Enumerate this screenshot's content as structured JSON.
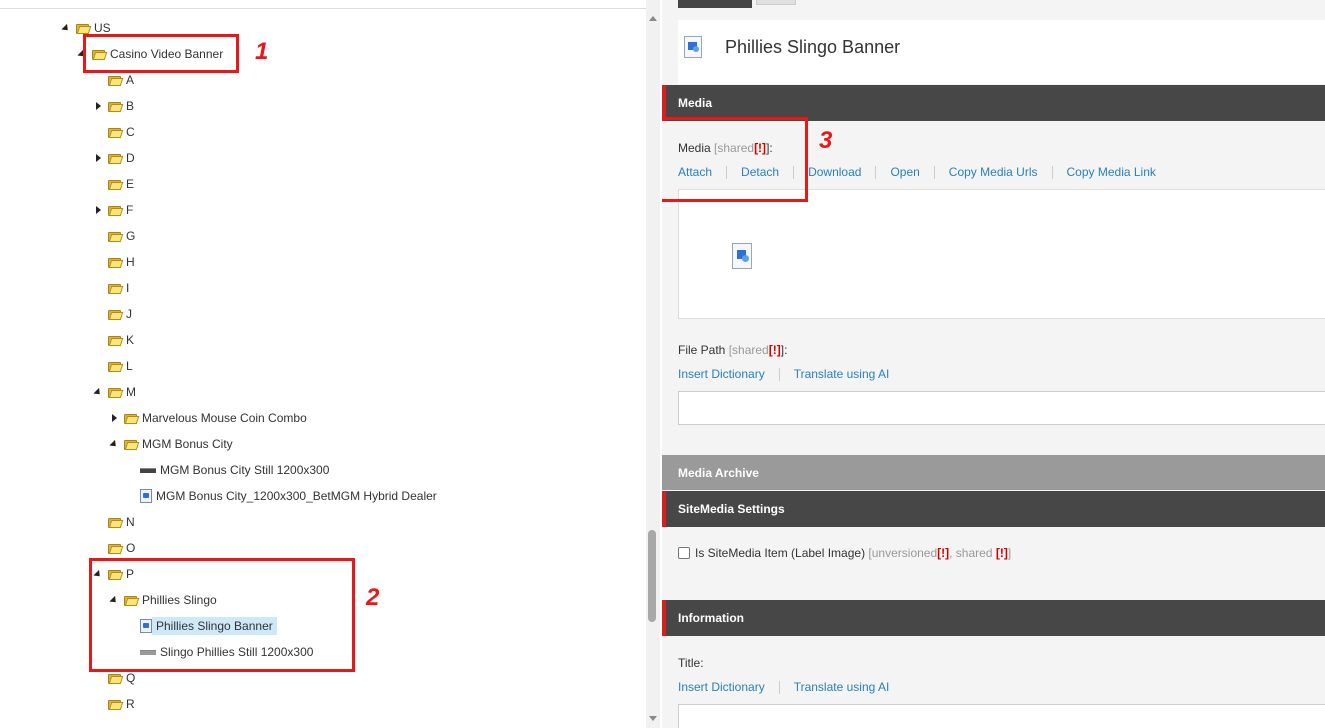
{
  "tree": {
    "nodes": [
      {
        "label": "US",
        "type": "folder",
        "expander": "down"
      },
      {
        "label": "Casino Video Banner",
        "type": "folder",
        "expander": "down"
      },
      {
        "label": "A",
        "type": "folder",
        "expander": "none"
      },
      {
        "label": "B",
        "type": "folder",
        "expander": "right"
      },
      {
        "label": "C",
        "type": "folder",
        "expander": "none"
      },
      {
        "label": "D",
        "type": "folder",
        "expander": "right"
      },
      {
        "label": "E",
        "type": "folder",
        "expander": "none"
      },
      {
        "label": "F",
        "type": "folder",
        "expander": "right"
      },
      {
        "label": "G",
        "type": "folder",
        "expander": "none"
      },
      {
        "label": "H",
        "type": "folder",
        "expander": "none"
      },
      {
        "label": "I",
        "type": "folder",
        "expander": "none"
      },
      {
        "label": "J",
        "type": "folder",
        "expander": "none"
      },
      {
        "label": "K",
        "type": "folder",
        "expander": "none"
      },
      {
        "label": "L",
        "type": "folder",
        "expander": "none"
      },
      {
        "label": "M",
        "type": "folder",
        "expander": "down"
      },
      {
        "label": "Marvelous Mouse Coin Combo",
        "type": "folder",
        "expander": "right"
      },
      {
        "label": "MGM Bonus City",
        "type": "folder",
        "expander": "down"
      },
      {
        "label": "MGM Bonus City Still 1200x300",
        "type": "image",
        "expander": "none"
      },
      {
        "label": "MGM Bonus City_1200x300_BetMGM Hybrid Dealer",
        "type": "media",
        "expander": "none"
      },
      {
        "label": "N",
        "type": "folder",
        "expander": "none"
      },
      {
        "label": "O",
        "type": "folder",
        "expander": "none"
      },
      {
        "label": "P",
        "type": "folder",
        "expander": "down"
      },
      {
        "label": "Phillies Slingo",
        "type": "folder",
        "expander": "down"
      },
      {
        "label": "Phillies Slingo Banner",
        "type": "media",
        "expander": "none",
        "selected": true
      },
      {
        "label": "Slingo Phillies Still 1200x300",
        "type": "image",
        "expander": "none"
      },
      {
        "label": "Q",
        "type": "folder",
        "expander": "none"
      },
      {
        "label": "R",
        "type": "folder",
        "expander": "none"
      }
    ]
  },
  "annotations": {
    "one": "1",
    "two": "2",
    "three": "3"
  },
  "editor": {
    "item_title": "Phillies Slingo Banner",
    "sections": {
      "media": "Media",
      "media_archive": "Media Archive",
      "sitemedia_settings": "SiteMedia Settings",
      "information": "Information"
    },
    "media_field": {
      "label": "Media",
      "shared": "[shared",
      "excl": "[!]",
      "close": "]:",
      "links": [
        "Attach",
        "Detach",
        "Download",
        "Open",
        "Copy Media Urls",
        "Copy Media Link"
      ]
    },
    "file_path_field": {
      "label": "File Path",
      "shared": "[shared",
      "excl": "[!]",
      "close": "]:",
      "links": [
        "Insert Dictionary",
        "Translate using AI"
      ],
      "value": ""
    },
    "sitemedia_checkbox": {
      "label": "Is SiteMedia Item (Label Image)",
      "meta_open": "[unversioned",
      "excl1": "[!]",
      "meta_mid": ", shared",
      "excl2": "[!]",
      "meta_close": "]",
      "checked": false
    },
    "title_field": {
      "label": "Title:",
      "links": [
        "Insert Dictionary",
        "Translate using AI"
      ],
      "value": ""
    }
  },
  "colors": {
    "section_dark": "#474747",
    "section_gray": "#9a9a9a",
    "accent_red": "#d42020",
    "link_blue": "#2a80c0",
    "annotation_red": "#e81818",
    "selection_blue": "#cde8f7"
  }
}
